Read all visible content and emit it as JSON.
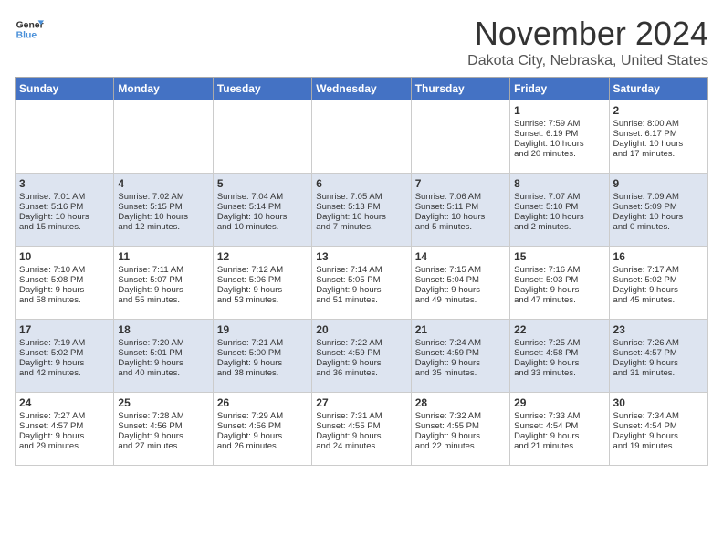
{
  "header": {
    "logo_line1": "General",
    "logo_line2": "Blue",
    "month_title": "November 2024",
    "location": "Dakota City, Nebraska, United States"
  },
  "days_of_week": [
    "Sunday",
    "Monday",
    "Tuesday",
    "Wednesday",
    "Thursday",
    "Friday",
    "Saturday"
  ],
  "weeks": [
    [
      {
        "day": "",
        "info": ""
      },
      {
        "day": "",
        "info": ""
      },
      {
        "day": "",
        "info": ""
      },
      {
        "day": "",
        "info": ""
      },
      {
        "day": "",
        "info": ""
      },
      {
        "day": "1",
        "info": "Sunrise: 7:59 AM\nSunset: 6:19 PM\nDaylight: 10 hours\nand 20 minutes."
      },
      {
        "day": "2",
        "info": "Sunrise: 8:00 AM\nSunset: 6:17 PM\nDaylight: 10 hours\nand 17 minutes."
      }
    ],
    [
      {
        "day": "3",
        "info": "Sunrise: 7:01 AM\nSunset: 5:16 PM\nDaylight: 10 hours\nand 15 minutes."
      },
      {
        "day": "4",
        "info": "Sunrise: 7:02 AM\nSunset: 5:15 PM\nDaylight: 10 hours\nand 12 minutes."
      },
      {
        "day": "5",
        "info": "Sunrise: 7:04 AM\nSunset: 5:14 PM\nDaylight: 10 hours\nand 10 minutes."
      },
      {
        "day": "6",
        "info": "Sunrise: 7:05 AM\nSunset: 5:13 PM\nDaylight: 10 hours\nand 7 minutes."
      },
      {
        "day": "7",
        "info": "Sunrise: 7:06 AM\nSunset: 5:11 PM\nDaylight: 10 hours\nand 5 minutes."
      },
      {
        "day": "8",
        "info": "Sunrise: 7:07 AM\nSunset: 5:10 PM\nDaylight: 10 hours\nand 2 minutes."
      },
      {
        "day": "9",
        "info": "Sunrise: 7:09 AM\nSunset: 5:09 PM\nDaylight: 10 hours\nand 0 minutes."
      }
    ],
    [
      {
        "day": "10",
        "info": "Sunrise: 7:10 AM\nSunset: 5:08 PM\nDaylight: 9 hours\nand 58 minutes."
      },
      {
        "day": "11",
        "info": "Sunrise: 7:11 AM\nSunset: 5:07 PM\nDaylight: 9 hours\nand 55 minutes."
      },
      {
        "day": "12",
        "info": "Sunrise: 7:12 AM\nSunset: 5:06 PM\nDaylight: 9 hours\nand 53 minutes."
      },
      {
        "day": "13",
        "info": "Sunrise: 7:14 AM\nSunset: 5:05 PM\nDaylight: 9 hours\nand 51 minutes."
      },
      {
        "day": "14",
        "info": "Sunrise: 7:15 AM\nSunset: 5:04 PM\nDaylight: 9 hours\nand 49 minutes."
      },
      {
        "day": "15",
        "info": "Sunrise: 7:16 AM\nSunset: 5:03 PM\nDaylight: 9 hours\nand 47 minutes."
      },
      {
        "day": "16",
        "info": "Sunrise: 7:17 AM\nSunset: 5:02 PM\nDaylight: 9 hours\nand 45 minutes."
      }
    ],
    [
      {
        "day": "17",
        "info": "Sunrise: 7:19 AM\nSunset: 5:02 PM\nDaylight: 9 hours\nand 42 minutes."
      },
      {
        "day": "18",
        "info": "Sunrise: 7:20 AM\nSunset: 5:01 PM\nDaylight: 9 hours\nand 40 minutes."
      },
      {
        "day": "19",
        "info": "Sunrise: 7:21 AM\nSunset: 5:00 PM\nDaylight: 9 hours\nand 38 minutes."
      },
      {
        "day": "20",
        "info": "Sunrise: 7:22 AM\nSunset: 4:59 PM\nDaylight: 9 hours\nand 36 minutes."
      },
      {
        "day": "21",
        "info": "Sunrise: 7:24 AM\nSunset: 4:59 PM\nDaylight: 9 hours\nand 35 minutes."
      },
      {
        "day": "22",
        "info": "Sunrise: 7:25 AM\nSunset: 4:58 PM\nDaylight: 9 hours\nand 33 minutes."
      },
      {
        "day": "23",
        "info": "Sunrise: 7:26 AM\nSunset: 4:57 PM\nDaylight: 9 hours\nand 31 minutes."
      }
    ],
    [
      {
        "day": "24",
        "info": "Sunrise: 7:27 AM\nSunset: 4:57 PM\nDaylight: 9 hours\nand 29 minutes."
      },
      {
        "day": "25",
        "info": "Sunrise: 7:28 AM\nSunset: 4:56 PM\nDaylight: 9 hours\nand 27 minutes."
      },
      {
        "day": "26",
        "info": "Sunrise: 7:29 AM\nSunset: 4:56 PM\nDaylight: 9 hours\nand 26 minutes."
      },
      {
        "day": "27",
        "info": "Sunrise: 7:31 AM\nSunset: 4:55 PM\nDaylight: 9 hours\nand 24 minutes."
      },
      {
        "day": "28",
        "info": "Sunrise: 7:32 AM\nSunset: 4:55 PM\nDaylight: 9 hours\nand 22 minutes."
      },
      {
        "day": "29",
        "info": "Sunrise: 7:33 AM\nSunset: 4:54 PM\nDaylight: 9 hours\nand 21 minutes."
      },
      {
        "day": "30",
        "info": "Sunrise: 7:34 AM\nSunset: 4:54 PM\nDaylight: 9 hours\nand 19 minutes."
      }
    ]
  ]
}
